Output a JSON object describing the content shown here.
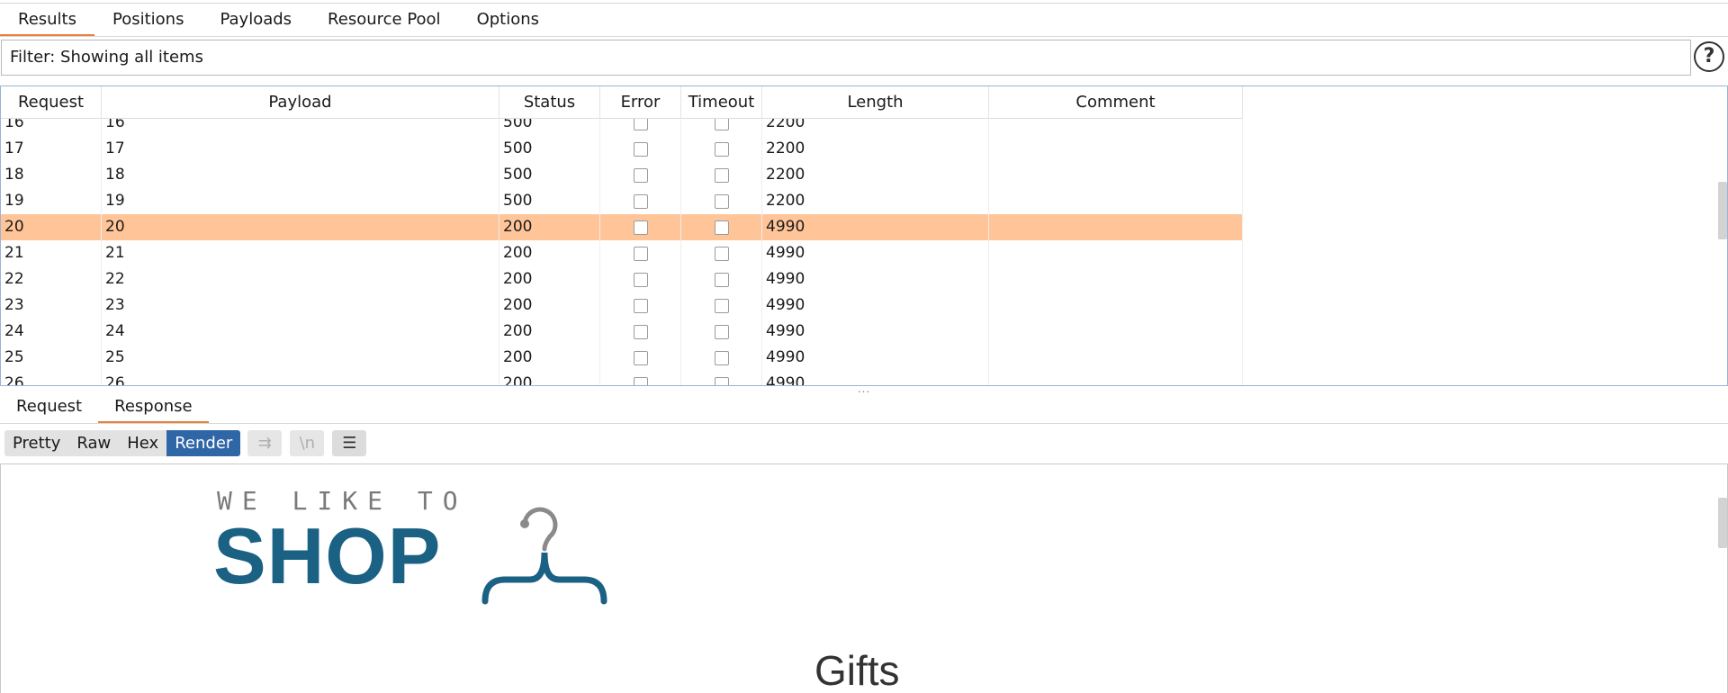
{
  "tabs": [
    "Results",
    "Positions",
    "Payloads",
    "Resource Pool",
    "Options"
  ],
  "filter": {
    "text": "Filter: Showing all items"
  },
  "help": {
    "glyph": "?"
  },
  "table": {
    "columns": [
      "Request",
      "Payload",
      "Status",
      "Error",
      "Timeout",
      "Length",
      "Comment"
    ],
    "rows": [
      {
        "request": "16",
        "payload": "16",
        "status": "500",
        "length": "2200",
        "selected": false
      },
      {
        "request": "17",
        "payload": "17",
        "status": "500",
        "length": "2200",
        "selected": false
      },
      {
        "request": "18",
        "payload": "18",
        "status": "500",
        "length": "2200",
        "selected": false
      },
      {
        "request": "19",
        "payload": "19",
        "status": "500",
        "length": "2200",
        "selected": false
      },
      {
        "request": "20",
        "payload": "20",
        "status": "200",
        "length": "4990",
        "selected": true
      },
      {
        "request": "21",
        "payload": "21",
        "status": "200",
        "length": "4990",
        "selected": false
      },
      {
        "request": "22",
        "payload": "22",
        "status": "200",
        "length": "4990",
        "selected": false
      },
      {
        "request": "23",
        "payload": "23",
        "status": "200",
        "length": "4990",
        "selected": false
      },
      {
        "request": "24",
        "payload": "24",
        "status": "200",
        "length": "4990",
        "selected": false
      },
      {
        "request": "25",
        "payload": "25",
        "status": "200",
        "length": "4990",
        "selected": false
      },
      {
        "request": "26",
        "payload": "26",
        "status": "200",
        "length": "4990",
        "selected": false
      }
    ]
  },
  "splitter": "...",
  "subtabs": [
    "Request",
    "Response"
  ],
  "toolbar": {
    "views": [
      "Pretty",
      "Raw",
      "Hex",
      "Render"
    ],
    "wrap_glyph": "⇉",
    "newline_glyph": "\\n",
    "menu_glyph": "☰"
  },
  "render": {
    "logo_tagline": "WE LIKE TO",
    "logo_word": "SHOP",
    "heading": "Gifts"
  },
  "colors": {
    "accent": "#e8803a",
    "selected_row": "#ffc599",
    "active_view": "#2f66a6",
    "logo": "#1a6184"
  }
}
